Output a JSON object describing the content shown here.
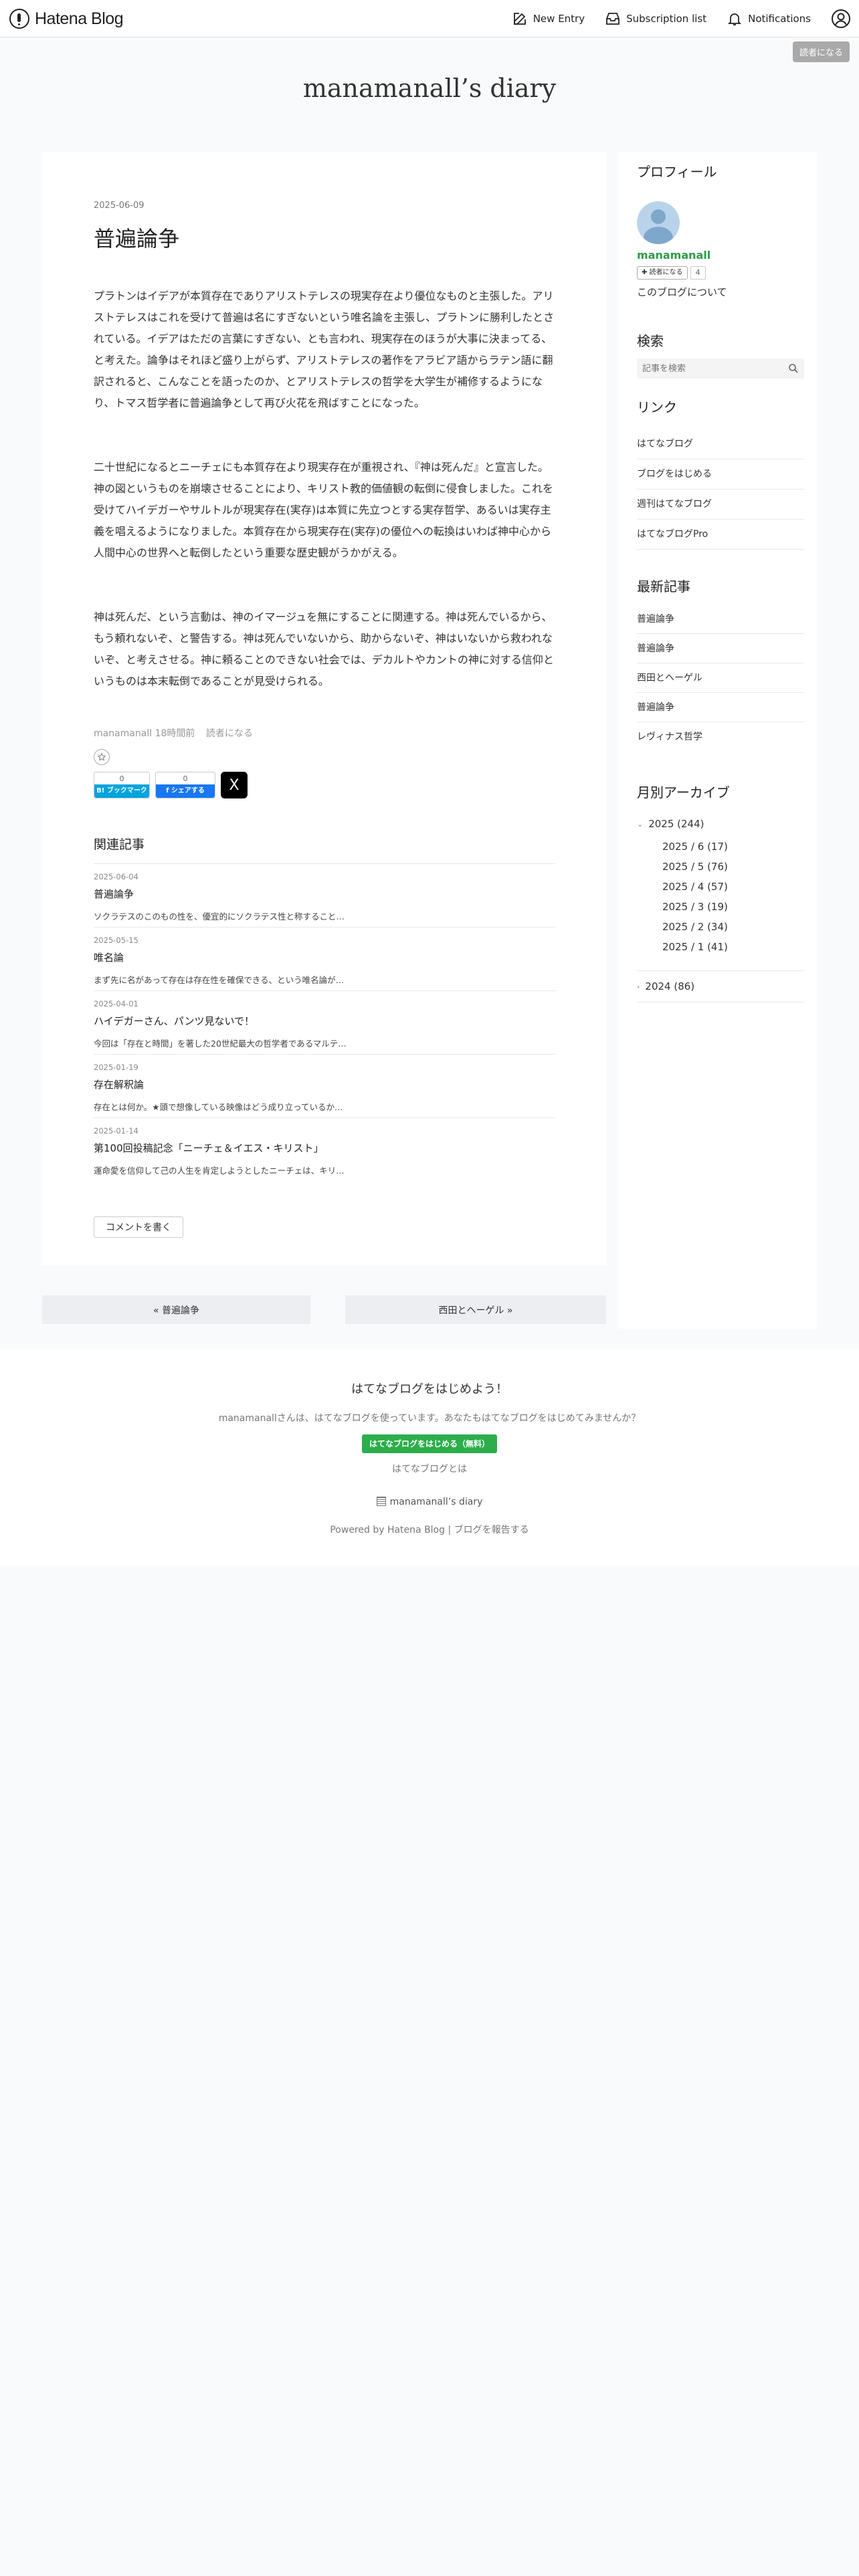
{
  "header": {
    "logo_text": "Hatena Blog",
    "new_entry": "New Entry",
    "subscription_list": "Subscription list",
    "notifications": "Notifications"
  },
  "subscribe_float": "読者になる",
  "blog_title": "manamanall’s diary",
  "entry": {
    "date": "2025-06-09",
    "title": "普遍論争",
    "paragraphs": [
      "プラトンはイデアが本質存在でありアリストテレスの現実存在より優位なものと主張した。アリストテレスはこれを受けて普遍は名にすぎないという唯名論を主張し、プラトンに勝利したとされている。イデアはただの言葉にすぎない、とも言われ、現実存在のほうが大事に決まってる、と考えた。論争はそれほど盛り上がらず、アリストテレスの著作をアラビア語からラテン語に翻訳されると、こんなことを語ったのか、とアリストテレスの哲学を大学生が補修するようになり、トマス哲学者に普遍論争として再び火花を飛ばすことになった。",
      "二十世紀になるとニーチェにも本質存在より現実存在が重視され、『神は死んだ』と宣言した。神の図というものを崩壊させることにより、キリスト教的価値観の転倒に侵食しました。これを受けてハイデガーやサルトルが現実存在(実存)は本質に先立つとする実存哲学、あるいは実存主義を唱えるようになりました。本質存在から現実存在(実存)の優位への転換はいわば神中心から人間中心の世界へと転倒したという重要な歴史観がうかがえる。",
      "神は死んだ、という言動は、神のイマージュを無にすることに関連する。神は死んでいるから、もう頼れないぞ、と警告する。神は死んでいないから、助からないぞ、神はいないから救われないぞ、と考えさせる。神に頼ることのできない社会では、デカルトやカントの神に対する信仰というものは本末転倒であることが見受けられる。"
    ],
    "author": "manamanall",
    "time_ago": "18時間前",
    "subscribe": "読者になる"
  },
  "share": {
    "hatena_count": "0",
    "hatena_label": "B! ブックマーク",
    "fb_count": "0",
    "fb_label": "f シェアする",
    "x_label": "X"
  },
  "related": {
    "heading": "関連記事",
    "items": [
      {
        "date": "2025-06-04",
        "title": "普遍論争",
        "snippet": "ソクラテスのこのもの性を、優宜的にソクラテス性と称すること…"
      },
      {
        "date": "2025-05-15",
        "title": "唯名論",
        "snippet": "まず先に名があって存在は存在性を確保できる、という唯名論が…"
      },
      {
        "date": "2025-04-01",
        "title": "ハイデガーさん、パンツ見ないで！",
        "snippet": "今回は「存在と時間」を著した20世紀最大の哲学者であるマルテ…"
      },
      {
        "date": "2025-01-19",
        "title": "存在解釈論",
        "snippet": "存在とは何か。★頭で想像している映像はどう成り立っているか…"
      },
      {
        "date": "2025-01-14",
        "title": "第100回投稿記念「ニーチェ＆イエス・キリスト」",
        "snippet": "運命愛を信仰して己の人生を肯定しようとしたニーチェは、キリ…"
      }
    ]
  },
  "comment_button": "コメントを書く",
  "sidebar": {
    "profile_heading": "プロフィール",
    "profile_name": "manamanall",
    "subscribe_btn": "✚ 読者になる",
    "subscriber_count": "4",
    "about": "このブログについて",
    "search_heading": "検索",
    "search_placeholder": "記事を検索",
    "links_heading": "リンク",
    "links": [
      "はてなブログ",
      "ブログをはじめる",
      "週刊はてなブログ",
      "はてなブログPro"
    ],
    "recent_heading": "最新記事",
    "recent": [
      "普遍論争",
      "普遍論争",
      "西田とヘーゲル",
      "普遍論争",
      "レヴィナス哲学"
    ],
    "archive_heading": "月別アーカイブ",
    "archive_2025": "2025 (244)",
    "archive_months": [
      "2025 / 6 (17)",
      "2025 / 5 (76)",
      "2025 / 4 (57)",
      "2025 / 3 (19)",
      "2025 / 2 (34)",
      "2025 / 1 (41)"
    ],
    "archive_2024": "2024 (86)"
  },
  "pager": {
    "prev": "« 普遍論争",
    "next": "西田とヘーゲル »"
  },
  "footer": {
    "heading": "はてなブログをはじめよう！",
    "text": "manamanallさんは、はてなブログを使っています。あなたもはてなブログをはじめてみませんか？",
    "start_button": "はてなブログをはじめる（無料）",
    "about": "はてなブログとは",
    "blog_link": "manamanall’s diary",
    "powered": "Powered by Hatena Blog",
    "report": "ブログを報告する"
  }
}
